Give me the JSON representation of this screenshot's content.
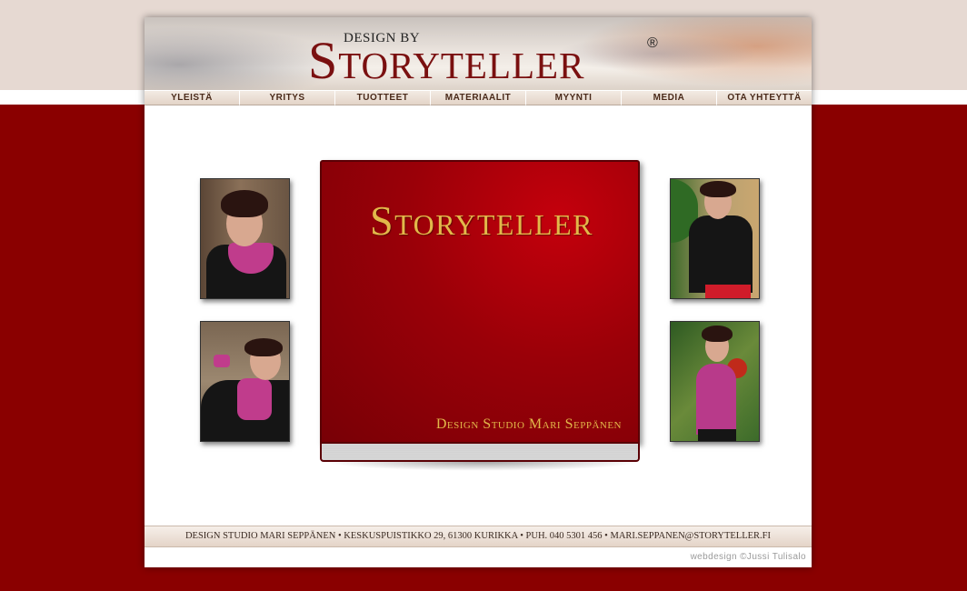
{
  "header": {
    "logo_small": "DESIGN BY",
    "logo_main": "Storyteller",
    "registered_mark": "®"
  },
  "nav": {
    "items": [
      "YLEISTÄ",
      "YRITYS",
      "TUOTTEET",
      "MATERIAALIT",
      "MYYNTI",
      "MEDIA",
      "OTA YHTEYTTÄ"
    ]
  },
  "book": {
    "title": "Storyteller",
    "subtitle": "Design Studio Mari Seppänen"
  },
  "footer": {
    "address": "DESIGN STUDIO MARI SEPPÄNEN • KESKUSPUISTIKKO 29, 61300 KURIKKA • PUH. 040 5301 456 • MARI.SEPPANEN@STORYTELLER.FI",
    "credit": "webdesign ©Jussi Tulisalo"
  },
  "colors": {
    "background_red": "#8a0000",
    "logo_red": "#7a1010",
    "book_gold": "#e2b84a"
  }
}
